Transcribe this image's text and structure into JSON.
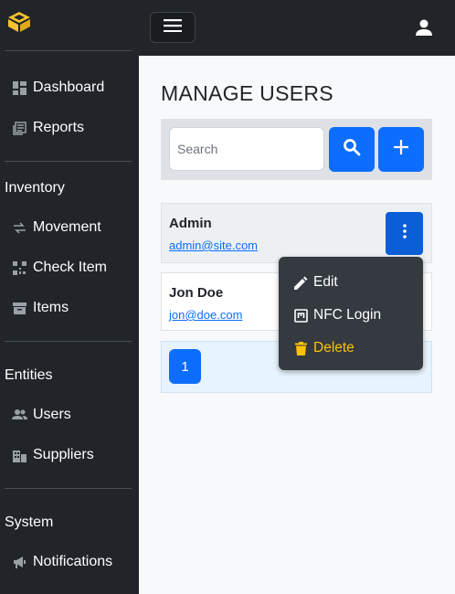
{
  "sidebar": {
    "logo_icon": "box-logo-icon",
    "nav": [
      {
        "label": "Dashboard",
        "icon": "dashboard-icon"
      },
      {
        "label": "Reports",
        "icon": "reports-icon"
      }
    ],
    "inventory": {
      "title": "Inventory",
      "items": [
        {
          "label": "Movement",
          "icon": "movement-icon"
        },
        {
          "label": "Check Item",
          "icon": "qr-code-icon"
        },
        {
          "label": "Items",
          "icon": "archive-icon"
        }
      ]
    },
    "entities": {
      "title": "Entities",
      "items": [
        {
          "label": "Users",
          "icon": "users-icon"
        },
        {
          "label": "Suppliers",
          "icon": "suppliers-icon"
        }
      ]
    },
    "system": {
      "title": "System",
      "items": [
        {
          "label": "Notifications",
          "icon": "megaphone-icon"
        }
      ]
    }
  },
  "topbar": {
    "menu_icon": "hamburger-icon",
    "user_icon": "user-icon"
  },
  "main": {
    "title": "MANAGE USERS",
    "search": {
      "placeholder": "Search",
      "value": ""
    },
    "users": [
      {
        "name": "Admin",
        "email": "admin@site.com"
      },
      {
        "name": "Jon Doe",
        "email": "jon@doe.com"
      }
    ],
    "pagination": {
      "current_page": "1"
    }
  },
  "dropdown": {
    "items": [
      {
        "label": "Edit",
        "icon": "pencil-icon"
      },
      {
        "label": "NFC Login",
        "icon": "nfc-icon"
      },
      {
        "label": "Delete",
        "icon": "trash-icon"
      }
    ]
  },
  "colors": {
    "primary": "#0d6efd",
    "dark": "#212529",
    "warning": "#ffc107"
  }
}
